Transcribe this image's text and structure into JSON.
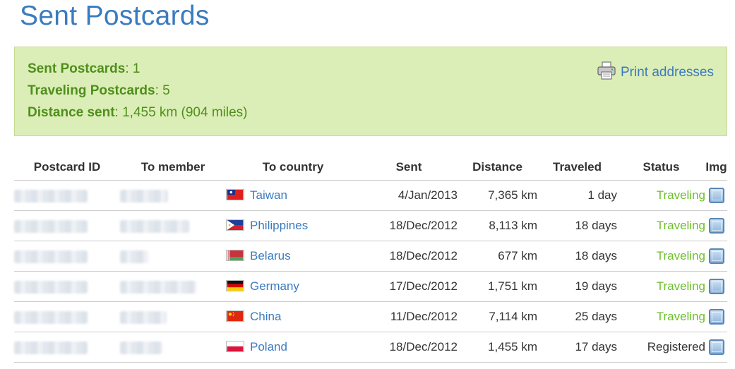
{
  "page": {
    "title": "Sent Postcards"
  },
  "summary": {
    "sent_label": "Sent Postcards",
    "sent_value": ": 1",
    "traveling_label": "Traveling Postcards",
    "traveling_value": ": 5",
    "distance_label": "Distance sent",
    "distance_value": ": 1,455 km (904 miles)",
    "print_link": "Print addresses"
  },
  "table": {
    "headers": {
      "postcard_id": "Postcard ID",
      "to_member": "To member",
      "to_country": "To country",
      "sent": "Sent",
      "distance": "Distance",
      "traveled": "Traveled",
      "status": "Status",
      "img": "Img"
    },
    "rows": [
      {
        "country": "Taiwan",
        "flag": "taiwan-flag",
        "sent": "4/Jan/2013",
        "distance": "7,365 km",
        "traveled": "1 day",
        "status": "Traveling"
      },
      {
        "country": "Philippines",
        "flag": "philippines-flag",
        "sent": "18/Dec/2012",
        "distance": "8,113 km",
        "traveled": "18 days",
        "status": "Traveling"
      },
      {
        "country": "Belarus",
        "flag": "belarus-flag",
        "sent": "18/Dec/2012",
        "distance": "677 km",
        "traveled": "18 days",
        "status": "Traveling"
      },
      {
        "country": "Germany",
        "flag": "germany-flag",
        "sent": "17/Dec/2012",
        "distance": "1,751 km",
        "traveled": "19 days",
        "status": "Traveling"
      },
      {
        "country": "China",
        "flag": "china-flag",
        "sent": "11/Dec/2012",
        "distance": "7,114 km",
        "traveled": "25 days",
        "status": "Traveling"
      },
      {
        "country": "Poland",
        "flag": "poland-flag",
        "sent": "18/Dec/2012",
        "distance": "1,455 km",
        "traveled": "17 days",
        "status": "Registered"
      }
    ]
  },
  "colors": {
    "title_blue": "#3a7bbf",
    "summary_bg": "#dceeb7",
    "summary_text": "#4e8f1c",
    "traveling_green": "#6cbf2a"
  }
}
